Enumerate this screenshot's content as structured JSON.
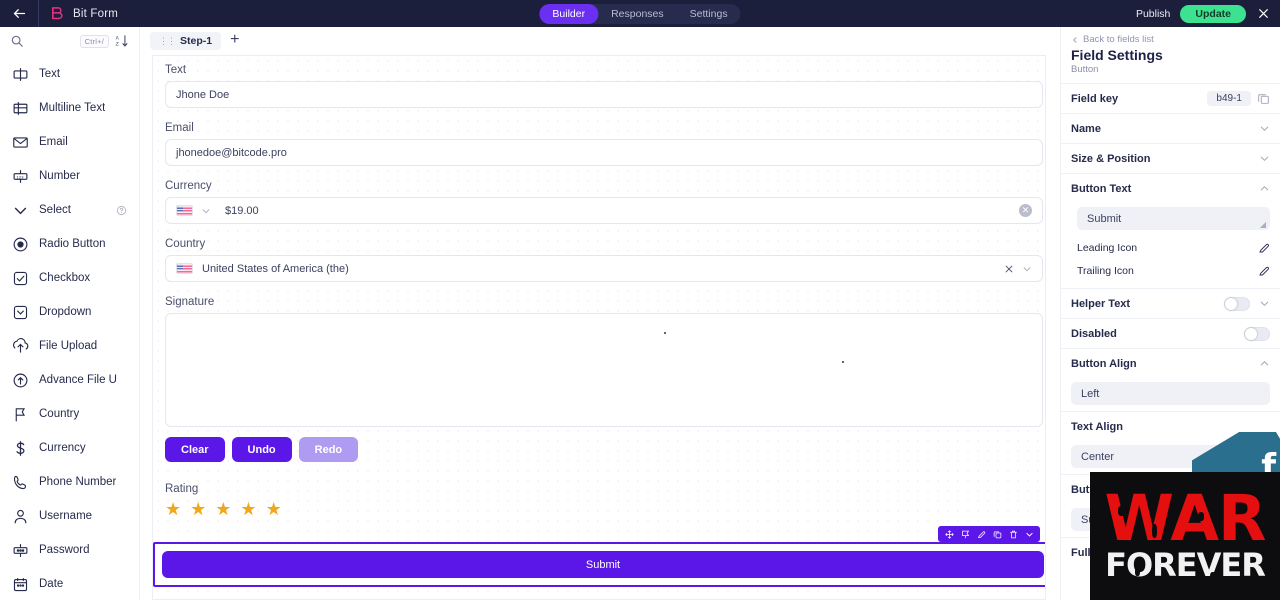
{
  "topbar": {
    "back_icon": "arrow-left-icon",
    "logo_icon": "bitform-logo-icon",
    "title": "Bit Form",
    "tabs": [
      {
        "label": "Builder",
        "active": true
      },
      {
        "label": "Responses",
        "active": false
      },
      {
        "label": "Settings",
        "active": false
      }
    ],
    "publish_label": "Publish",
    "update_label": "Update",
    "close_icon": "close-icon",
    "accent_active": "#6a2ff0",
    "accent_update": "#3ce28f",
    "background": "#1b1f3b"
  },
  "sidebar": {
    "search": {
      "icon": "search-icon",
      "shortcut": "Ctrl+/",
      "sort_icon": "sort-az-icon"
    },
    "items": [
      {
        "label": "Text",
        "icon": "text-field-icon"
      },
      {
        "label": "Multiline Text",
        "icon": "multiline-text-icon"
      },
      {
        "label": "Email",
        "icon": "email-icon"
      },
      {
        "label": "Number",
        "icon": "number-icon"
      },
      {
        "label": "Select",
        "icon": "chevron-down-icon",
        "help": true
      },
      {
        "label": "Radio Button",
        "icon": "radio-button-icon"
      },
      {
        "label": "Checkbox",
        "icon": "checkbox-icon"
      },
      {
        "label": "Dropdown",
        "icon": "dropdown-icon"
      },
      {
        "label": "File Upload",
        "icon": "file-upload-icon"
      },
      {
        "label": "Advance File U",
        "icon": "advance-file-upload-icon"
      },
      {
        "label": "Country",
        "icon": "flag-icon"
      },
      {
        "label": "Currency",
        "icon": "dollar-icon"
      },
      {
        "label": "Phone Number",
        "icon": "phone-icon"
      },
      {
        "label": "Username",
        "icon": "user-icon"
      },
      {
        "label": "Password",
        "icon": "password-icon"
      },
      {
        "label": "Date",
        "icon": "calendar-icon"
      }
    ]
  },
  "canvas": {
    "step": {
      "label": "Step-1",
      "grip_icon": "drag-grip-icon"
    },
    "add_step_label": "+",
    "fields": {
      "text": {
        "label": "Text",
        "value": "Jhone Doe"
      },
      "email": {
        "label": "Email",
        "value": "jhonedoe@bitcode.pro"
      },
      "currency": {
        "label": "Currency",
        "value": "$19.00",
        "flag_icon": "us-flag-icon",
        "clear_icon": "clear-circle-icon"
      },
      "country": {
        "label": "Country",
        "value": "United States of America (the)",
        "flag_icon": "us-flag-icon",
        "clear_icon": "close-icon",
        "chevron_icon": "chevron-down-icon"
      },
      "signature": {
        "label": "Signature",
        "buttons": [
          {
            "label": "Clear",
            "style": "solid"
          },
          {
            "label": "Undo",
            "style": "solid"
          },
          {
            "label": "Redo",
            "style": "muted"
          }
        ]
      },
      "rating": {
        "label": "Rating",
        "stars": 5,
        "star_color": "#f0a818"
      },
      "submit": {
        "label": "Submit",
        "selected": true,
        "toolbar_icons": [
          "move-icon",
          "flag-icon",
          "edit-icon",
          "duplicate-icon",
          "trash-icon",
          "chevron-down-icon"
        ]
      }
    }
  },
  "right_panel": {
    "back_label": "Back to fields list",
    "title": "Field Settings",
    "subtitle": "Button",
    "field_key_label": "Field key",
    "field_key_value": "b49-1",
    "copy_icon": "copy-icon",
    "sections": [
      {
        "label": "Name",
        "state": "collapsed"
      },
      {
        "label": "Size & Position",
        "state": "collapsed"
      },
      {
        "label": "Button Text",
        "state": "expanded"
      }
    ],
    "button_text_value": "Submit",
    "leading_icon_label": "Leading Icon",
    "trailing_icon_label": "Trailing Icon",
    "helper_text_label": "Helper Text",
    "disabled_label": "Disabled",
    "button_align_label": "Button Align",
    "button_align_value": "Left",
    "text_align_label": "Text Align",
    "text_align_value": "Center",
    "button_size_label": "Butto",
    "button_size_value": "Su",
    "full_width_label": "Full V"
  },
  "watermark": {
    "line1": "WAR",
    "line2": "FOREVER",
    "glyph": "f",
    "red": "#e60f0f",
    "white": "#f2f2f2",
    "background": "#0d0d0f",
    "blue": "#2b6f8f"
  }
}
